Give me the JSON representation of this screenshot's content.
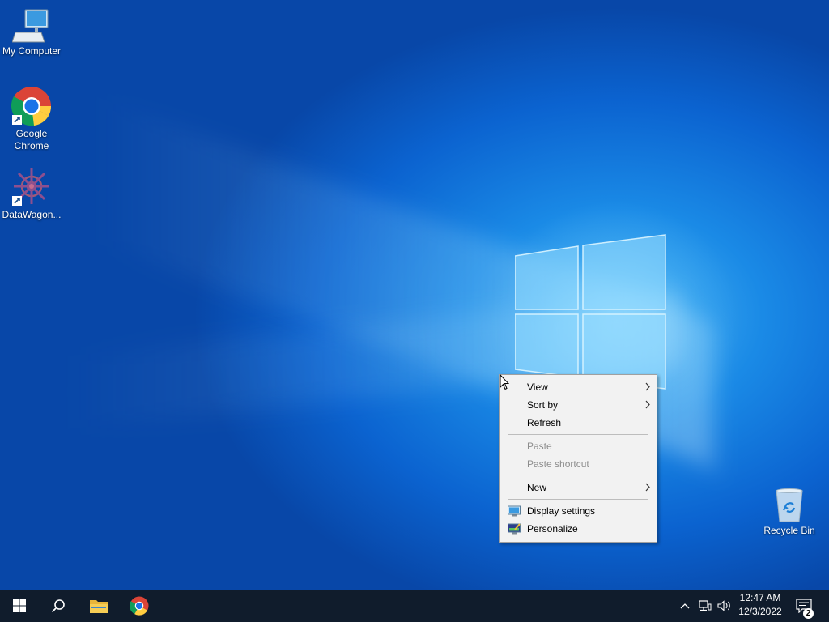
{
  "desktop": {
    "icons": [
      {
        "label": "My Computer",
        "icon": "computer-icon"
      },
      {
        "label_line1": "Google",
        "label_line2": "Chrome",
        "icon": "chrome-icon",
        "shortcut": true
      },
      {
        "label": "DataWagon...",
        "icon": "datawagon-icon",
        "shortcut": true
      },
      {
        "label": "Recycle Bin",
        "icon": "recycle-bin-icon"
      }
    ]
  },
  "context_menu": {
    "items": [
      {
        "label": "View",
        "submenu": true,
        "enabled": true
      },
      {
        "label": "Sort by",
        "submenu": true,
        "enabled": true
      },
      {
        "label": "Refresh",
        "enabled": true
      },
      {
        "label": "Paste",
        "enabled": false
      },
      {
        "label": "Paste shortcut",
        "enabled": false
      },
      {
        "label": "New",
        "submenu": true,
        "enabled": true
      },
      {
        "label": "Display settings",
        "icon": "display-icon",
        "enabled": true
      },
      {
        "label": "Personalize",
        "icon": "personalize-icon",
        "enabled": true
      }
    ]
  },
  "taskbar": {
    "buttons": [
      "start-icon",
      "search-icon",
      "file-explorer-icon",
      "chrome-icon"
    ],
    "tray": [
      "chevron-up-icon",
      "network-icon",
      "volume-icon"
    ],
    "time": "12:47 AM",
    "date": "12/3/2022",
    "notification_count": "2"
  },
  "colors": {
    "taskbar": "#101c2c",
    "menu_bg": "#f2f2f2",
    "desktop_accent": "#0b63d0"
  }
}
